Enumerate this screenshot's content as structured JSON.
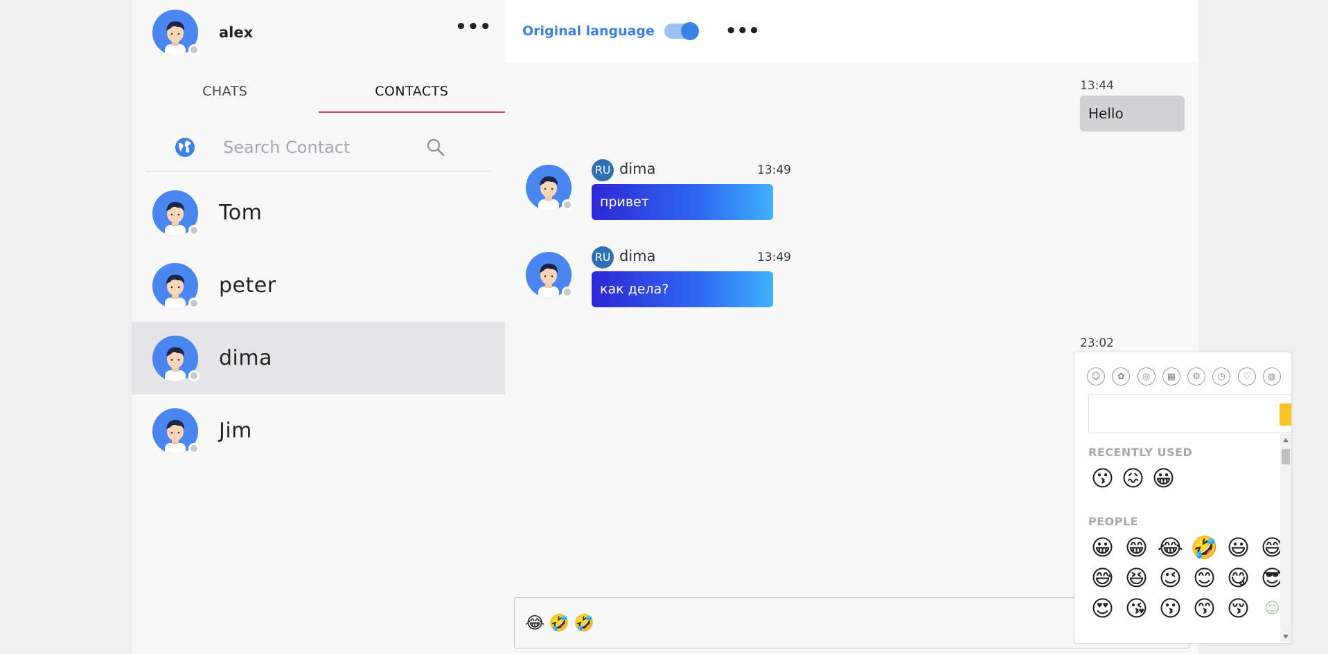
{
  "user": {
    "name": "alex"
  },
  "tabs": [
    {
      "label": "CHATS"
    },
    {
      "label": "CONTACTS"
    }
  ],
  "search": {
    "placeholder": "Search Contact",
    "value": ""
  },
  "contacts": [
    {
      "name": "Tom"
    },
    {
      "name": "peter"
    },
    {
      "name": "dima",
      "selected": true
    },
    {
      "name": "Jim"
    }
  ],
  "header": {
    "original_language_label": "Original language",
    "toggle_on": true
  },
  "messages": {
    "out1": {
      "time": "13:44",
      "text": "Hello"
    },
    "in1": {
      "lang": "RU",
      "sender": "dima",
      "time": "13:49",
      "text": "привет"
    },
    "in2": {
      "lang": "RU",
      "sender": "dima",
      "time": "13:49",
      "text": "как дела?"
    },
    "out2": {
      "time": "23:02"
    }
  },
  "composer": {
    "content": [
      "😂",
      "🤣",
      "🤣"
    ]
  },
  "emoji_picker": {
    "categories": [
      "people-icon",
      "nature-icon",
      "food-icon",
      "activity-icon",
      "travel-icon",
      "objects-icon",
      "symbols-icon",
      "flags-icon"
    ],
    "recently_used_title": "RECENTLY USED",
    "recently_used": [
      "😗",
      "😖",
      "😀"
    ],
    "people_title": "PEOPLE",
    "people": [
      [
        "😀",
        "😁",
        "😂",
        "🤣",
        "😃",
        "😄"
      ],
      [
        "😅",
        "😆",
        "😉",
        "😊",
        "😋",
        "😎"
      ],
      [
        "😍",
        "😘",
        "😗",
        "😙",
        "😚",
        "☺"
      ]
    ]
  },
  "colors": {
    "accent": "#3b82e6",
    "tab_underline": "#d43a6a",
    "selected_row": "#e4e4e6"
  }
}
